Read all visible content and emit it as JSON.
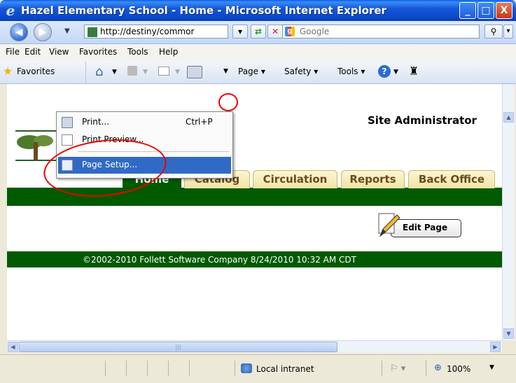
{
  "window": {
    "title": "Hazel Elementary School - Home - Microsoft Internet Explorer",
    "minimize_glyph": "_",
    "maximize_glyph": "□",
    "close_glyph": "X"
  },
  "address_bar": {
    "url": "http://destiny/commor",
    "search_placeholder": "Google"
  },
  "menubar": {
    "items": [
      "File",
      "Edit",
      "View",
      "Favorites",
      "Tools",
      "Help"
    ]
  },
  "command_bar": {
    "favorites": "Favorites",
    "page": "Page",
    "safety": "Safety",
    "tools": "Tools"
  },
  "print_menu": {
    "items": [
      {
        "label": "Print...",
        "shortcut": "Ctrl+P"
      },
      {
        "label": "Print Preview...",
        "shortcut": ""
      },
      {
        "label": "Page Setup...",
        "shortcut": ""
      }
    ],
    "highlighted_index": 2
  },
  "page": {
    "site_admin": "Site Administrator",
    "tabs": [
      "Home",
      "Catalog",
      "Circulation",
      "Reports",
      "Back Office"
    ],
    "active_tab": "Home",
    "edit_page_label": "Edit Page",
    "footer_text": "©2002-2010  Follett Software Company     8/24/2010 10:32 AM CDT"
  },
  "statusbar": {
    "zone": "Local intranet",
    "zoom": "100%"
  },
  "colors": {
    "title_bar": "#0A5FE7",
    "site_green": "#005A00",
    "tab_face": "#F5ECBD",
    "menu_highlight": "#316AC5",
    "annotation_red": "#E00000"
  },
  "icons": [
    "ie-logo-icon",
    "back-icon",
    "forward-icon",
    "refresh-icon",
    "stop-icon",
    "google-icon",
    "search-icon",
    "star-icon",
    "home-icon",
    "feeds-icon",
    "mail-icon",
    "printer-icon",
    "help-icon",
    "research-icon",
    "page-setup-icon",
    "print-preview-icon",
    "pencil-icon",
    "intranet-icon",
    "zoom-icon"
  ]
}
